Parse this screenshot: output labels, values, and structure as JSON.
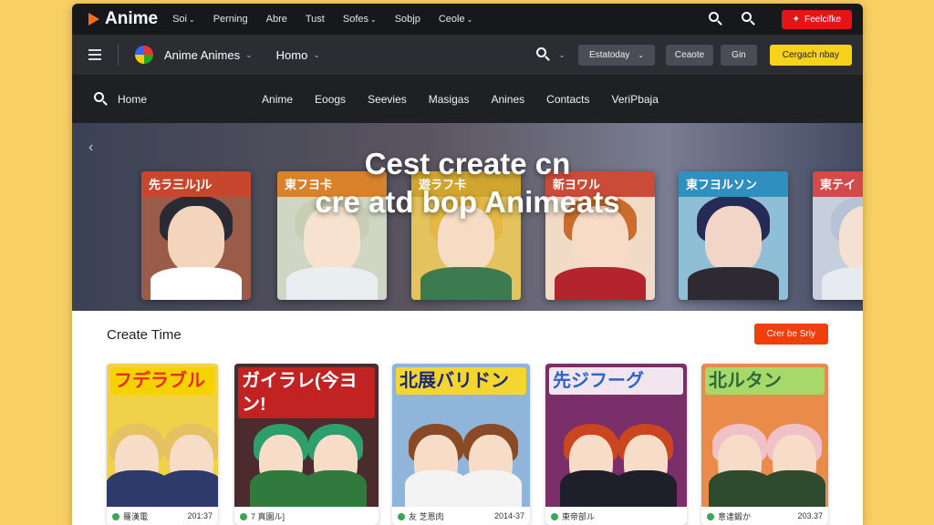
{
  "topbar": {
    "logo": "Anime",
    "menu": [
      {
        "label": "Soi",
        "chevron": true
      },
      {
        "label": "Perning",
        "chevron": false
      },
      {
        "label": "Abre",
        "chevron": false
      },
      {
        "label": "Tust",
        "chevron": false
      },
      {
        "label": "Sofes",
        "chevron": true
      },
      {
        "label": "Sobjp",
        "chevron": false
      },
      {
        "label": "Ceole",
        "chevron": true
      }
    ],
    "cta": "Feelcifke"
  },
  "navbar": {
    "brand": "Anime Animes",
    "home_dropdown": "Homo",
    "date_dropdown": "Estatoday",
    "btn_create": "Ceaote",
    "btn_sign": "Gin",
    "btn_cta": "Cergach nbay"
  },
  "menubar": {
    "home": "Home",
    "links": [
      "Anime",
      "Eoogs",
      "Seevies",
      "Masigas",
      "Anines",
      "Contacts",
      "VeriPbaja"
    ]
  },
  "hero": {
    "title_line1": "Cest create cn",
    "title_line2": "cre atd bop   Animeats",
    "cards": [
      {
        "label": "先ラ三ル]ル",
        "band": "#c6462e",
        "hair": "#2a2a35",
        "skin": "#f3d5bd",
        "body": "#ffffff",
        "bg": "#9a5c48"
      },
      {
        "label": "東フヨ卡",
        "band": "#d9822e",
        "hair": "#c9cdb3",
        "skin": "#f7e2cf",
        "body": "#e9eef0",
        "bg": "#cfd7c4"
      },
      {
        "label": "遊ラフ卡",
        "band": "#d0a530",
        "hair": "#e3b844",
        "skin": "#f7dcc4",
        "body": "#3c7a4f",
        "bg": "#e2c35d"
      },
      {
        "label": "新ヨワル",
        "band": "#c94b38",
        "hair": "#c96c2c",
        "skin": "#f8dbc6",
        "body": "#b4242c",
        "bg": "#f0dbc6"
      },
      {
        "label": "東フヨルソン",
        "band": "#2f8fbf",
        "hair": "#252b56",
        "skin": "#f1d6c8",
        "body": "#2e2a33",
        "bg": "#8ebfd6"
      },
      {
        "label": "東テイ",
        "band": "#d34a4a",
        "hair": "#b6c3d6",
        "skin": "#f5e0d4",
        "body": "#e7ebf0",
        "bg": "#c6cfdb"
      }
    ]
  },
  "section": {
    "title": "Create Time",
    "action": "Crer be Sriy",
    "covers": [
      {
        "title": "フデラブル",
        "title_color": "#e62d1f",
        "title_bg": "#f6d300",
        "bg": "#f2d14a",
        "hair": "#e5c261",
        "body": "#2c3b6c",
        "meta_left": "羅漢電",
        "meta_right": "201:37"
      },
      {
        "title": "ガイラレ(今ヨン!",
        "title_color": "#ffffff",
        "title_bg": "#c12222",
        "bg": "#4b2b2d",
        "hair": "#2f9e6d",
        "body": "#2f7a3c",
        "meta_left": "7 真園ル]",
        "meta_right": ""
      },
      {
        "title": "北展バリドン",
        "title_color": "#172a7c",
        "title_bg": "#f5d52f",
        "bg": "#8fb6da",
        "hair": "#8a4a25",
        "body": "#f3f3f3",
        "meta_left": "友 芝恩肉",
        "meta_right": "2014-37"
      },
      {
        "title": "先ジフーグ",
        "title_color": "#2c64c9",
        "title_bg": "#f1e5f0",
        "bg": "#7a2f6b",
        "hair": "#c9461f",
        "body": "#1f1f2b",
        "meta_left": "東帝部ル",
        "meta_right": ""
      },
      {
        "title": "北ルタン",
        "title_color": "#2b6a3b",
        "title_bg": "#a6d86a",
        "bg": "#e98c4a",
        "hair": "#f0c2c7",
        "body": "#2e4a2f",
        "meta_left": "意達鍛か",
        "meta_right": "203.37"
      }
    ]
  }
}
